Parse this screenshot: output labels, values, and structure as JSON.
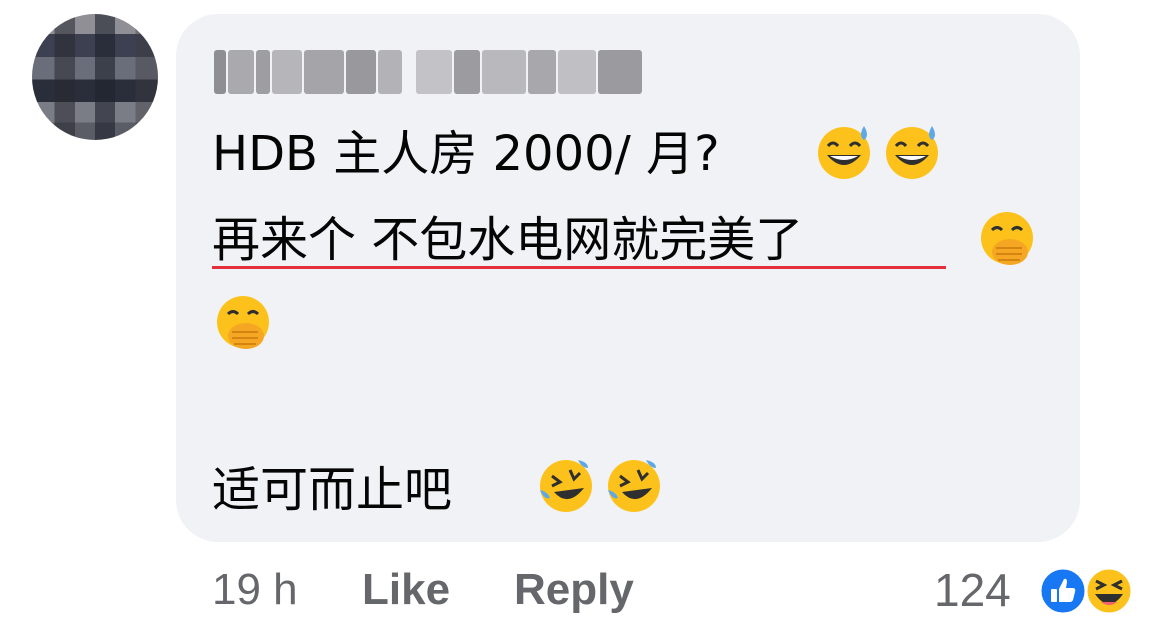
{
  "comment": {
    "author_name": "",
    "lines": [
      "HDB 主人房 2000/ 月?",
      "再来个 不包水电网就完美了",
      "",
      "适可而止吧"
    ],
    "emojis": {
      "line1": [
        "grinning-face-with-sweat",
        "grinning-face-with-sweat"
      ],
      "line2": [
        "face-with-hand-over-mouth",
        "face-with-hand-over-mouth"
      ],
      "line4": [
        "rolling-on-the-floor-laughing",
        "rolling-on-the-floor-laughing"
      ]
    },
    "underline_color": "#e4303a"
  },
  "actions": {
    "time": "19 h",
    "like_label": "Like",
    "reply_label": "Reply"
  },
  "reactions": {
    "count": "124",
    "icons": [
      "like-reaction-icon",
      "haha-reaction-icon"
    ],
    "like_color": "#1877f2"
  },
  "colors": {
    "bubble_bg": "#f0f2f5",
    "text": "#050505",
    "meta": "#65676b"
  }
}
